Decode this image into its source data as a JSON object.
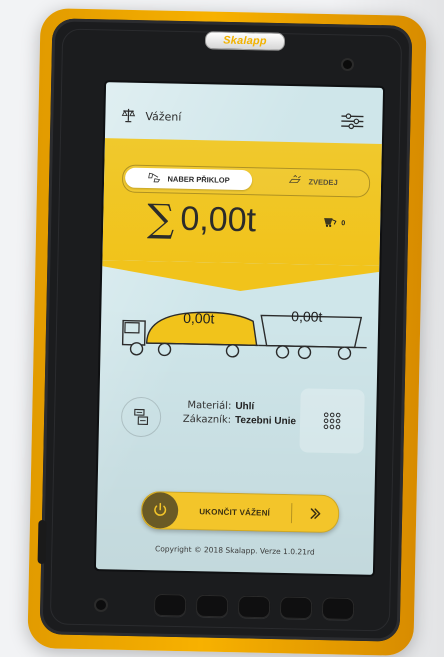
{
  "device": {
    "brand_logo": "Skalapp"
  },
  "app": {
    "title": "Vážení"
  },
  "tabs": [
    {
      "label": "NABER PŘIKLOP"
    },
    {
      "label": "ZVEDEJ"
    }
  ],
  "summary": {
    "total": "0,00t",
    "bucket_count": "0"
  },
  "vehicles": {
    "truck_weight": "0,00t",
    "trailer_weight": "0,00t"
  },
  "info": {
    "material_label": "Materiál:",
    "material_value": "Uhlí",
    "customer_label": "Zákazník:",
    "customer_value": "Tezebni Unie"
  },
  "actions": {
    "finish_label": "UKONČIT VÁŽENÍ"
  },
  "footer": {
    "copyright": "Copyright © 2018 Skalapp. Verze 1.0.21rd"
  }
}
